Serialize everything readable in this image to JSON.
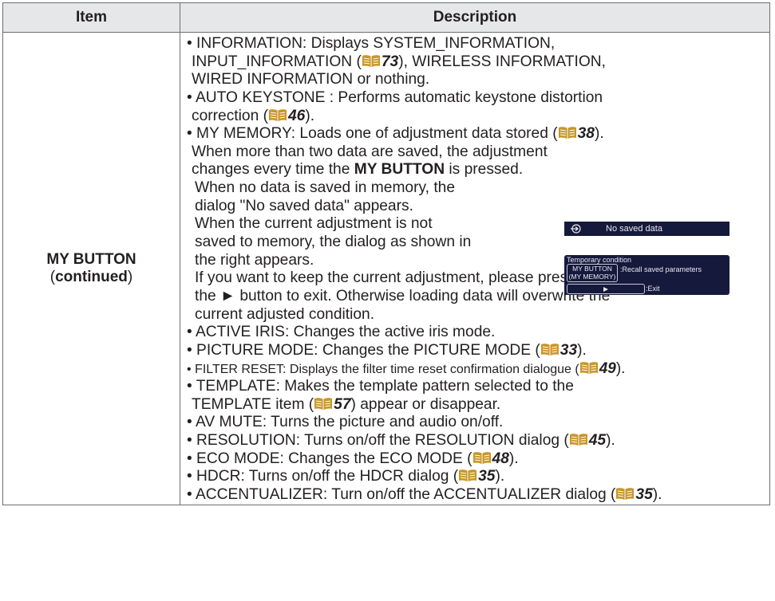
{
  "header": {
    "item": "Item",
    "description": "Description"
  },
  "row": {
    "item_title": "MY BUTTON",
    "item_sub": "continued",
    "colors": {
      "header_bg": "#e6e7e8",
      "border": "#6d6e71",
      "ref_icon": "#c8962a",
      "dialog_bg": "#151a3c"
    },
    "lines": {
      "l1": "• INFORMATION: Displays SYSTEM_INFORMATION,",
      "l2a": "INPUT_INFORMATION (",
      "l2ref": "73",
      "l2b": "), WIRELESS INFORMATION,",
      "l3": "WIRED INFORMATION or nothing.",
      "l4": "• AUTO KEYSTONE : Performs automatic keystone distortion",
      "l5a": "correction (",
      "l5ref": "46",
      "l5b": ").",
      "l6a": "• MY MEMORY: Loads one of adjustment data stored (",
      "l6ref": "38",
      "l6b": ").",
      "l7": "When more than two data are saved, the adjustment",
      "l8a": "changes every time the ",
      "l8b": "MY BUTTON",
      "l8c": " is pressed.",
      "l9": "When no data is saved in memory, the",
      "l10": "dialog \"No saved data\" appears.",
      "l11": "When the current adjustment is not",
      "l12": "saved to memory, the dialog as shown in",
      "l13": "the right appears.",
      "l14": "If you want to keep the current adjustment, please press",
      "l15": "the ► button to exit. Otherwise loading data will overwrite the",
      "l16": "current adjusted condition.",
      "l17": "• ACTIVE IRIS: Changes the active iris mode.",
      "l18a": "• PICTURE MODE: Changes the PICTURE MODE (",
      "l18ref": "33",
      "l18b": ").",
      "l19a": "• FILTER RESET: Displays the filter time reset confirmation dialogue (",
      "l19ref": "49",
      "l19b": ").",
      "l20": "• TEMPLATE: Makes the template pattern selected to the",
      "l21a": "TEMPLATE item (",
      "l21ref": "57",
      "l21b": ") appear or disappear.",
      "l22": "• AV MUTE: Turns the picture and audio on/off.",
      "l23a": "• RESOLUTION: Turns on/off the RESOLUTION dialog (",
      "l23ref": "45",
      "l23b": ").",
      "l24a": "• ECO MODE: Changes the ECO MODE (",
      "l24ref": "48",
      "l24b": ").",
      "l25a": "• HDCR: Turns on/off the HDCR dialog (",
      "l25ref": "35",
      "l25b": ").",
      "l26a": "• ACCENTUALIZER: Turn on/off the ACCENTUALIZER dialog (",
      "l26ref": "35",
      "l26b": ")."
    },
    "dialog_no_saved": {
      "icon": "input-arrow-icon",
      "text": "No saved data"
    },
    "dialog_temp": {
      "title": "Temporary condition",
      "btn1_line1": "MY BUTTON",
      "btn1_line2": "(MY MEMORY)",
      "label1": ":Recall saved parameters",
      "label2": ":Exit",
      "btn2_icon": "right-arrow-icon"
    }
  }
}
